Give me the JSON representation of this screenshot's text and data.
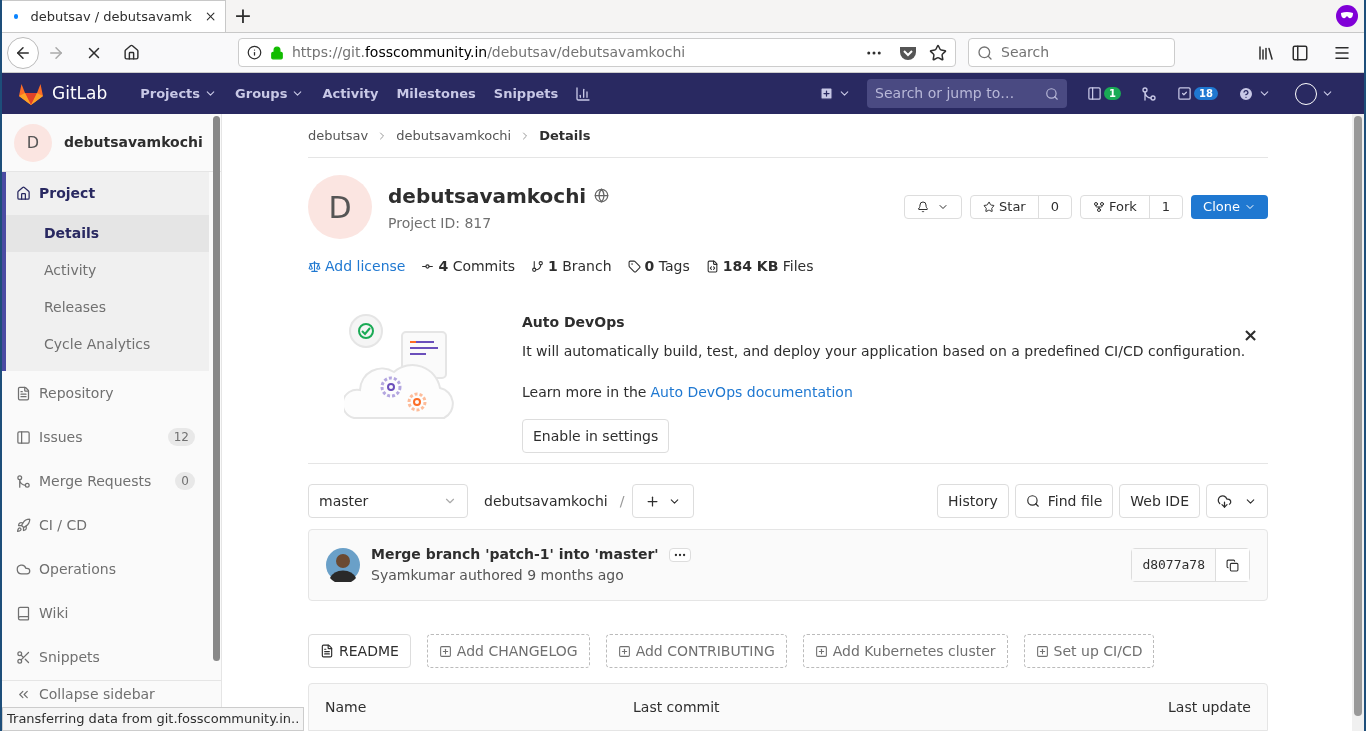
{
  "browser": {
    "tab": {
      "title": "debutsav / debutsavamk"
    },
    "new_tab": "+",
    "url": {
      "prefix": "https://git.",
      "domain": "fosscommunity.in",
      "path": "/debutsav/debutsavamkochi"
    },
    "search": {
      "placeholder": "Search"
    }
  },
  "navbar": {
    "logo": "GitLab",
    "menu": [
      {
        "label": "Projects",
        "dropdown": true
      },
      {
        "label": "Groups",
        "dropdown": true
      },
      {
        "label": "Activity",
        "dropdown": false
      },
      {
        "label": "Milestones",
        "dropdown": false
      },
      {
        "label": "Snippets",
        "dropdown": false
      }
    ],
    "search": {
      "placeholder": "Search or jump to…"
    },
    "issues_count": "1",
    "todos_count": "18"
  },
  "sidebar": {
    "initial": "D",
    "project": "debutsavamkochi",
    "items": [
      {
        "label": "Project",
        "kind": "home",
        "selected": true,
        "children": [
          {
            "label": "Details",
            "selected": true
          },
          {
            "label": "Activity",
            "selected": false
          },
          {
            "label": "Releases",
            "selected": false
          },
          {
            "label": "Cycle Analytics",
            "selected": false
          }
        ]
      },
      {
        "label": "Repository",
        "kind": "doc",
        "selected": false
      },
      {
        "label": "Issues",
        "kind": "issues",
        "selected": false,
        "count": "12"
      },
      {
        "label": "Merge Requests",
        "kind": "mr",
        "selected": false,
        "count": "0"
      },
      {
        "label": "CI / CD",
        "kind": "rocket",
        "selected": false
      },
      {
        "label": "Operations",
        "kind": "cloud",
        "selected": false
      },
      {
        "label": "Wiki",
        "kind": "book",
        "selected": false
      },
      {
        "label": "Snippets",
        "kind": "scissors",
        "selected": false
      }
    ],
    "collapse": "Collapse sidebar"
  },
  "breadcrumbs": [
    "debutsav",
    "debutsavamkochi",
    "Details"
  ],
  "project": {
    "initial": "D",
    "name": "debutsavamkochi",
    "id": "Project ID: 817",
    "star": "Star",
    "star_count": "0",
    "fork": "Fork",
    "fork_count": "1",
    "clone": "Clone"
  },
  "stats": [
    {
      "kind": "license",
      "text": "Add license"
    },
    {
      "kind": "commits",
      "text": "**4** Commits"
    },
    {
      "kind": "branch",
      "text": "**1** Branch"
    },
    {
      "kind": "tags",
      "text": "**0** Tags"
    },
    {
      "kind": "files",
      "text": "**184 KB** Files"
    }
  ],
  "auto_devops": {
    "title": "Auto DevOps",
    "text": "It will automatically build, test, and deploy your application based on a predefined CI/CD configuration.",
    "learn": "Learn more in the",
    "link": "Auto DevOps documentation",
    "button": "Enable in settings",
    "close": "×"
  },
  "repo": {
    "branch": "master",
    "path": "debutsavamkochi",
    "separator": "/",
    "buttons": [
      "History",
      "Find file",
      "Web IDE"
    ]
  },
  "commit": {
    "message": "Merge branch 'patch-1' into 'master'",
    "meta": "Syamkumar authored 9 months ago",
    "sha": "d8077a78"
  },
  "quick_actions": [
    {
      "kind": "existing",
      "label": "README"
    },
    {
      "kind": "add",
      "label": "Add CHANGELOG"
    },
    {
      "kind": "add",
      "label": "Add CONTRIBUTING"
    },
    {
      "kind": "add",
      "label": "Add Kubernetes cluster"
    },
    {
      "kind": "add",
      "label": "Set up CI/CD"
    }
  ],
  "table": {
    "columns": [
      "Name",
      "Last commit",
      "Last update"
    ]
  },
  "status": "Transferring data from git.fosscommunity.in.."
}
